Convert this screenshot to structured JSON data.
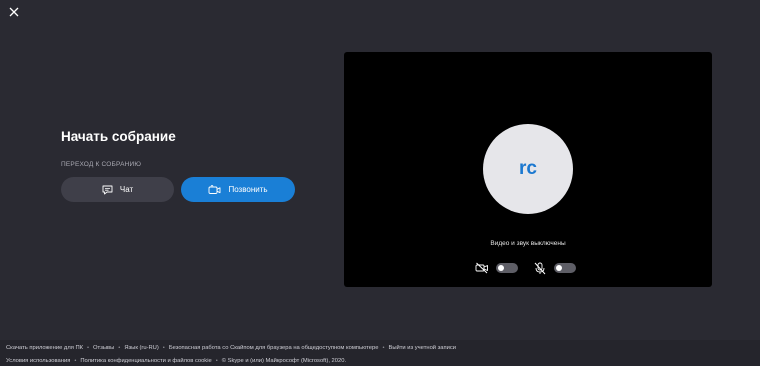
{
  "window": {
    "close_icon": "close-icon"
  },
  "meeting": {
    "title": "Начать собрание",
    "subtitle": "ПЕРЕХОД К СОБРАНИЮ",
    "chat_button": {
      "label": "Чат",
      "icon": "chat-icon"
    },
    "call_button": {
      "label": "Позвонить",
      "icon": "video-call-icon"
    }
  },
  "preview": {
    "avatar_initials": "rc",
    "status_text": "Видео и звук выключены",
    "video_toggle": {
      "icon": "camera-off-icon",
      "state": "off"
    },
    "audio_toggle": {
      "icon": "mic-off-icon",
      "state": "off"
    }
  },
  "colors": {
    "background": "#2a2a32",
    "primary_button": "#1a7fd6",
    "secondary_button": "#3f3f49",
    "avatar_bg": "#e6e6ea",
    "avatar_text": "#1b78d0"
  },
  "footer": {
    "links_row1": [
      "Скачать приложение для ПК",
      "Отзывы",
      "Язык (ru-RU)",
      "Безопасная работа со Скайпом для браузера на общедоступном компьютере",
      "Выйти из учетной записи"
    ],
    "links_row2": [
      "Условия использования",
      "Политика конфиденциальности и файлов cookie",
      "© Skype и (или) Майкрософт (Microsoft), 2020."
    ],
    "separator": "•"
  }
}
